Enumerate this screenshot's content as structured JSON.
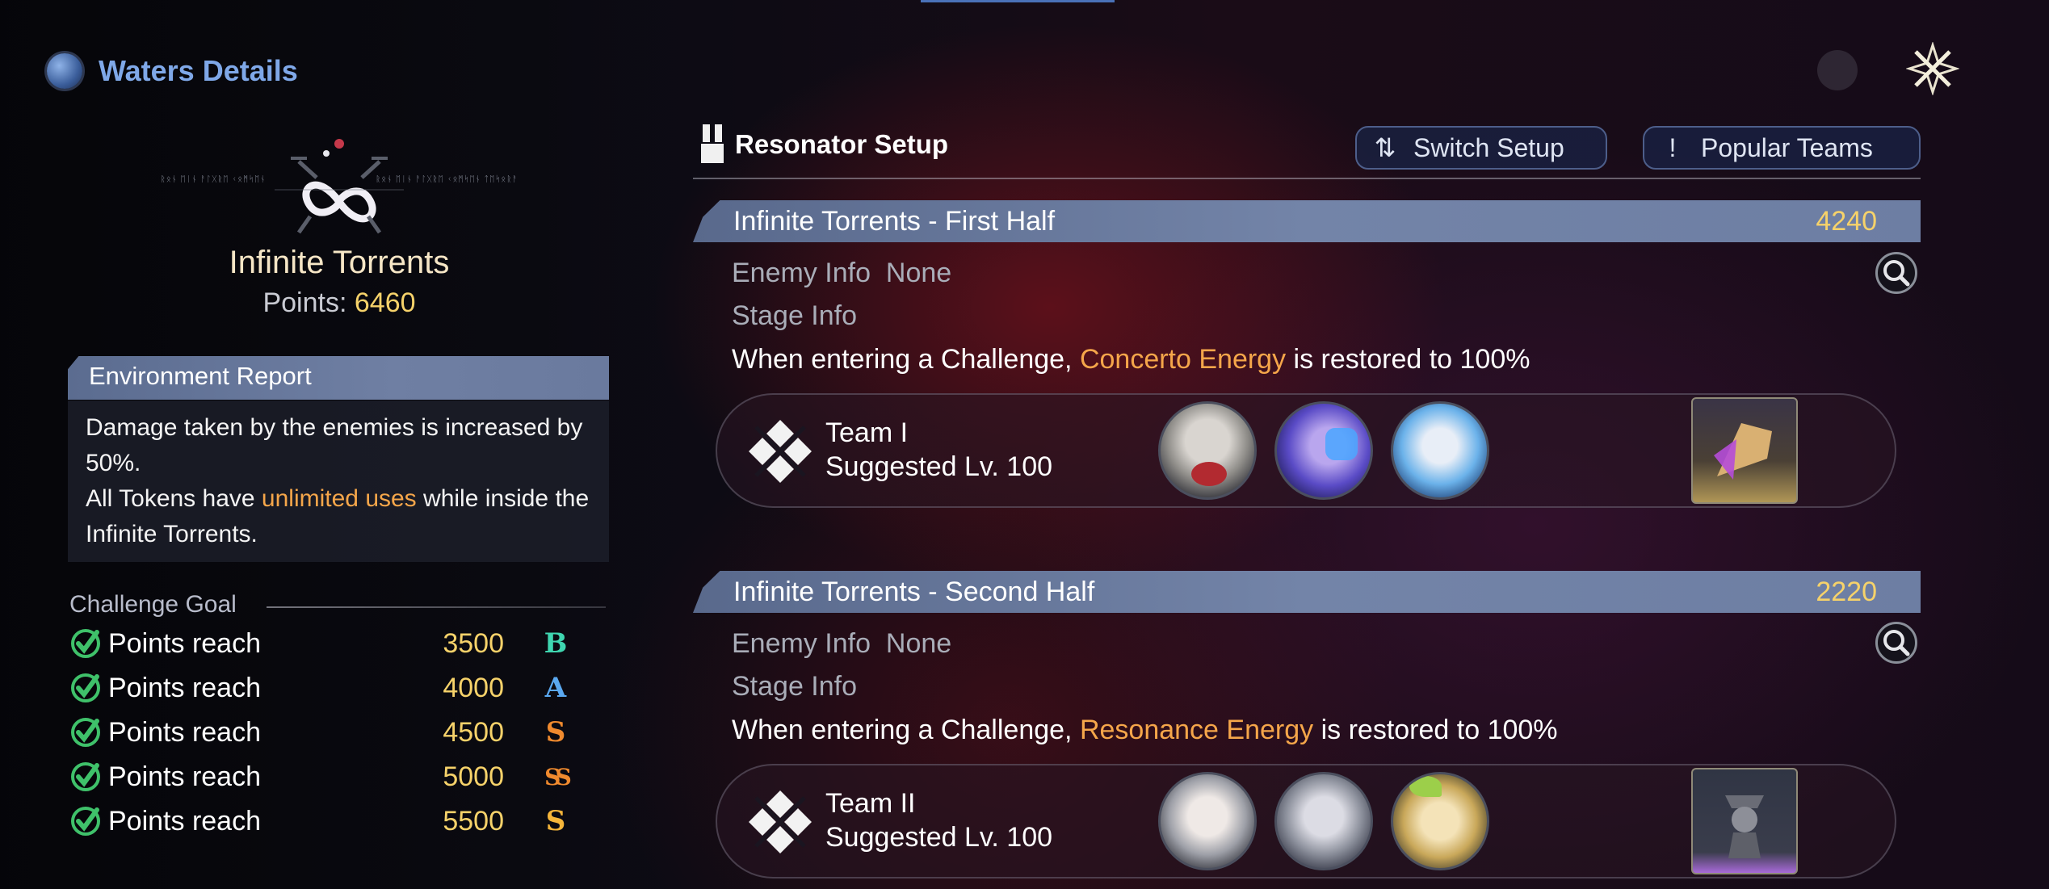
{
  "header": {
    "title": "Waters Details"
  },
  "stage": {
    "name": "Infinite Torrents",
    "points_label": "Points:",
    "points_value": "6460"
  },
  "environment": {
    "title": "Environment Report",
    "line1": "Damage taken by the enemies is increased by 50%.",
    "line2_pre": "All Tokens have ",
    "line2_highlight": "unlimited uses",
    "line2_post": " while inside the Infinite Torrents."
  },
  "challenge": {
    "title": "Challenge Goal",
    "goals": [
      {
        "label": "Points reach",
        "value": "3500",
        "rank": "B",
        "rank_color": "#3fd6b0"
      },
      {
        "label": "Points reach",
        "value": "4000",
        "rank": "A",
        "rank_color": "#5aa8f0"
      },
      {
        "label": "Points reach",
        "value": "4500",
        "rank": "S",
        "rank_color": "#f08a2e"
      },
      {
        "label": "Points reach",
        "value": "5000",
        "rank": "SS",
        "rank_color": "#f08a2e"
      },
      {
        "label": "Points reach",
        "value": "5500",
        "rank": "S",
        "rank_color": "#f5b53a"
      }
    ]
  },
  "setup": {
    "title": "Resonator Setup",
    "switch_label": "Switch Setup",
    "popular_label": "Popular Teams"
  },
  "halves": [
    {
      "title": "Infinite Torrents - First Half",
      "score": "4240",
      "enemy_label": "Enemy Info",
      "enemy_value": "None",
      "stage_label": "Stage Info",
      "stage_pre": "When entering a Challenge, ",
      "stage_highlight": "Concerto Energy",
      "stage_post": " is restored to 100%",
      "team_name": "Team I",
      "team_level": "Suggested Lv. 100"
    },
    {
      "title": "Infinite Torrents - Second Half",
      "score": "2220",
      "enemy_label": "Enemy Info",
      "enemy_value": "None",
      "stage_label": "Stage Info",
      "stage_pre": "When entering a Challenge, ",
      "stage_highlight": "Resonance Energy",
      "stage_post": " is restored to 100%",
      "team_name": "Team II",
      "team_level": "Suggested Lv. 100"
    }
  ],
  "colors": {
    "accent_blue": "#7fa8e8",
    "gold": "#f6d26a",
    "orange": "#f5a64a",
    "check_green": "#3fc16a"
  }
}
